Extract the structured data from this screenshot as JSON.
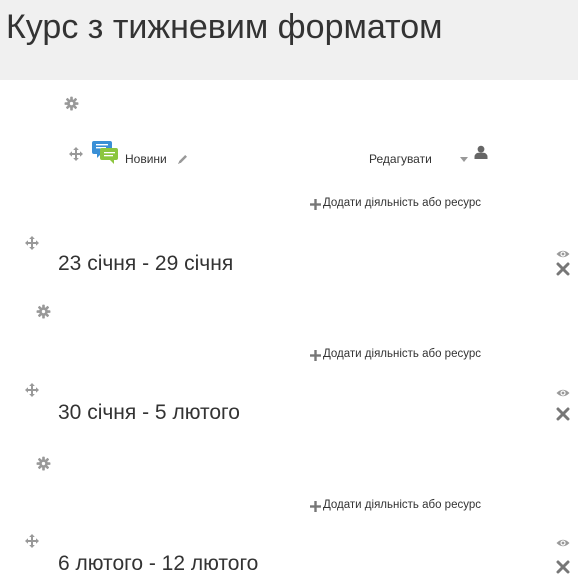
{
  "page": {
    "title": "Курс з тижневим форматом"
  },
  "news": {
    "label": "Новини",
    "edit_label": "Редагувати"
  },
  "add_activity_label": "Додати діяльність або ресурс",
  "sections": [
    {
      "title": "23 січня - 29 січня"
    },
    {
      "title": "30 січня - 5 лютого"
    },
    {
      "title": "6 лютого - 12 лютого"
    }
  ],
  "icons": {
    "gear": "gear-icon",
    "move": "move-icon",
    "forum": "forum-icon",
    "pencil": "pencil-icon",
    "caret": "chevron-down-icon",
    "user": "user-icon",
    "plus": "plus-icon",
    "eye": "eye-icon",
    "close": "close-icon"
  },
  "colors": {
    "header_bg": "#f0f0f0",
    "text": "#333333",
    "icon_gray": "#999999",
    "close_gray": "#777777",
    "forum_blue": "#3a8fd6",
    "forum_green": "#8cc63f"
  }
}
